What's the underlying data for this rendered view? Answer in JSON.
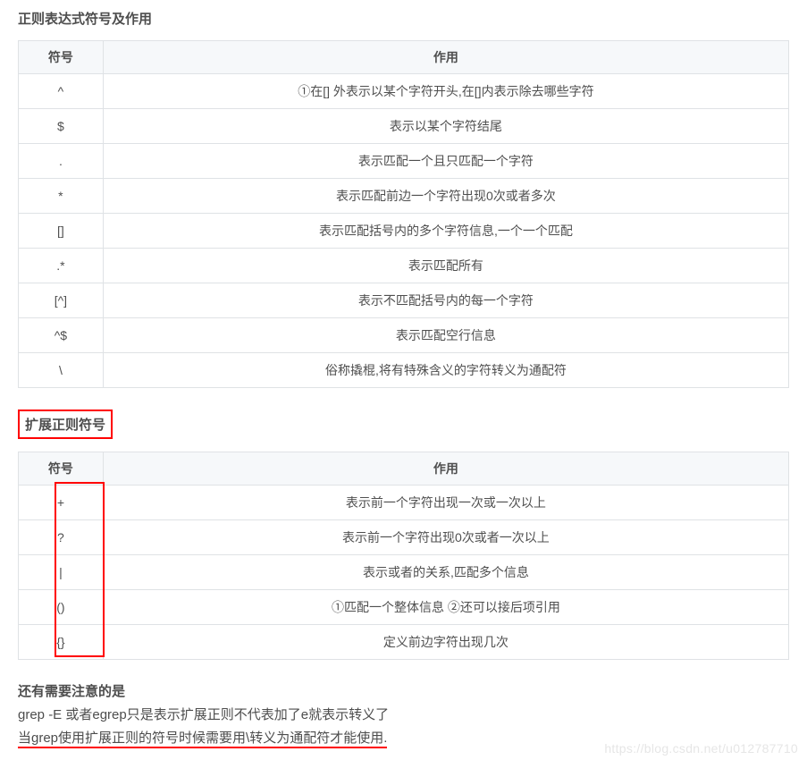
{
  "section1": {
    "title": "正则表达式符号及作用",
    "headers": {
      "symbol": "符号",
      "usage": "作用"
    },
    "rows": [
      {
        "symbol": "^",
        "usage": "①在[] 外表示以某个字符开头,在[]内表示除去哪些字符"
      },
      {
        "symbol": "$",
        "usage": "表示以某个字符结尾"
      },
      {
        "symbol": ".",
        "usage": "表示匹配一个且只匹配一个字符"
      },
      {
        "symbol": "*",
        "usage": "表示匹配前边一个字符出现0次或者多次"
      },
      {
        "symbol": "[]",
        "usage": "表示匹配括号内的多个字符信息,一个一个匹配"
      },
      {
        "symbol": ".*",
        "usage": "表示匹配所有"
      },
      {
        "symbol": "[^]",
        "usage": "表示不匹配括号内的每一个字符"
      },
      {
        "symbol": "^$",
        "usage": "表示匹配空行信息"
      },
      {
        "symbol": "\\",
        "usage": "俗称撬棍,将有特殊含义的字符转义为通配符"
      }
    ]
  },
  "section2": {
    "title": "扩展正则符号",
    "headers": {
      "symbol": "符号",
      "usage": "作用"
    },
    "rows": [
      {
        "symbol": "+",
        "usage": "表示前一个字符出现一次或一次以上"
      },
      {
        "symbol": "?",
        "usage": "表示前一个字符出现0次或者一次以上"
      },
      {
        "symbol": "|",
        "usage": "表示或者的关系,匹配多个信息"
      },
      {
        "symbol": "()",
        "usage": "①匹配一个整体信息 ②还可以接后项引用"
      },
      {
        "symbol": "{}",
        "usage": "定义前边字符出现几次"
      }
    ]
  },
  "notes": {
    "title": "还有需要注意的是",
    "line1": "grep -E 或者egrep只是表示扩展正则不代表加了e就表示转义了",
    "line2": "当grep使用扩展正则的符号时候需要用\\转义为通配符才能使用."
  },
  "watermark": "https://blog.csdn.net/u012787710"
}
